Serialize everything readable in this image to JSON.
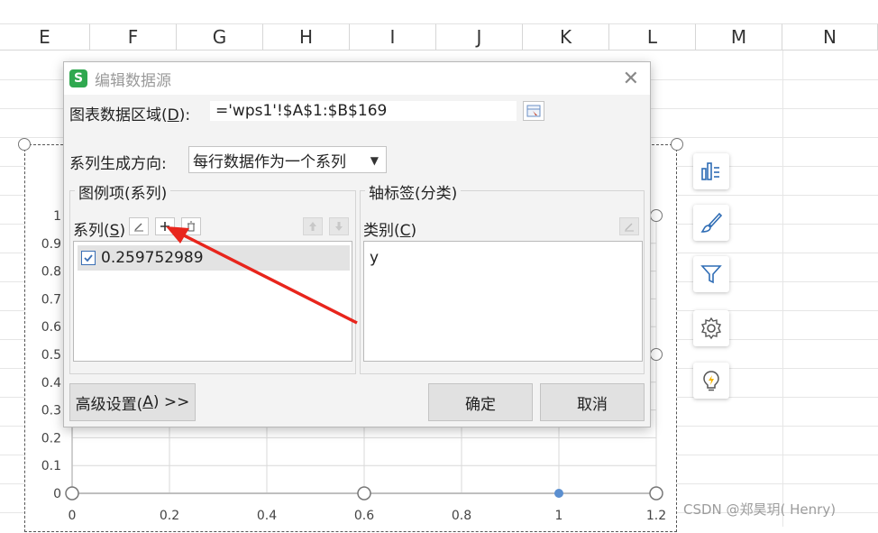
{
  "sheet": {
    "columns": [
      "E",
      "F",
      "G",
      "H",
      "I",
      "J",
      "K",
      "L",
      "M",
      "N"
    ]
  },
  "chart_data": {
    "type": "line",
    "x_ticks": [
      "0",
      "0.2",
      "0.4",
      "0.6",
      "0.8",
      "1",
      "1.2"
    ],
    "y_ticks": [
      "0",
      "0.1",
      "0.2",
      "0.3",
      "0.4",
      "0.5",
      "0.6",
      "0.7",
      "0.8",
      "0.9",
      "1"
    ],
    "xlim": [
      0,
      1.2
    ],
    "ylim": [
      0,
      1
    ],
    "grid": true,
    "series": [
      {
        "values": [
          {
            "x": 1,
            "y": 0
          }
        ]
      }
    ],
    "colors": {
      "point": "#5b8fd0",
      "grid": "#d9d9d9",
      "axis": "#bfbfbf"
    }
  },
  "side_tools": [
    {
      "icon": "chart-elements-icon"
    },
    {
      "icon": "brush-icon"
    },
    {
      "icon": "filter-icon"
    },
    {
      "icon": "settings-icon"
    },
    {
      "icon": "lightbulb-icon"
    }
  ],
  "dialog": {
    "title": "编辑数据源",
    "logo": "S",
    "range_label_pre": "图表数据区域(",
    "range_label_key": "D",
    "range_label_post": "):",
    "range_value": "='wps1'!$A$1:$B$169",
    "direction_label": "系列生成方向:",
    "direction_value": "每行数据作为一个系列",
    "legend_group": "图例项(系列)",
    "series_label_pre": "系列(",
    "series_label_key": "S",
    "series_label_post": ")",
    "series_items": [
      "0.259752989"
    ],
    "axis_group": "轴标签(分类)",
    "category_label_pre": "类别(",
    "category_label_key": "C",
    "category_label_post": ")",
    "category_items": [
      "y"
    ],
    "advanced_pre": "高级设置(",
    "advanced_key": "A",
    "advanced_post": ") >>",
    "ok": "确定",
    "cancel": "取消"
  },
  "watermark": "CSDN @郑昊玥( Henry)"
}
